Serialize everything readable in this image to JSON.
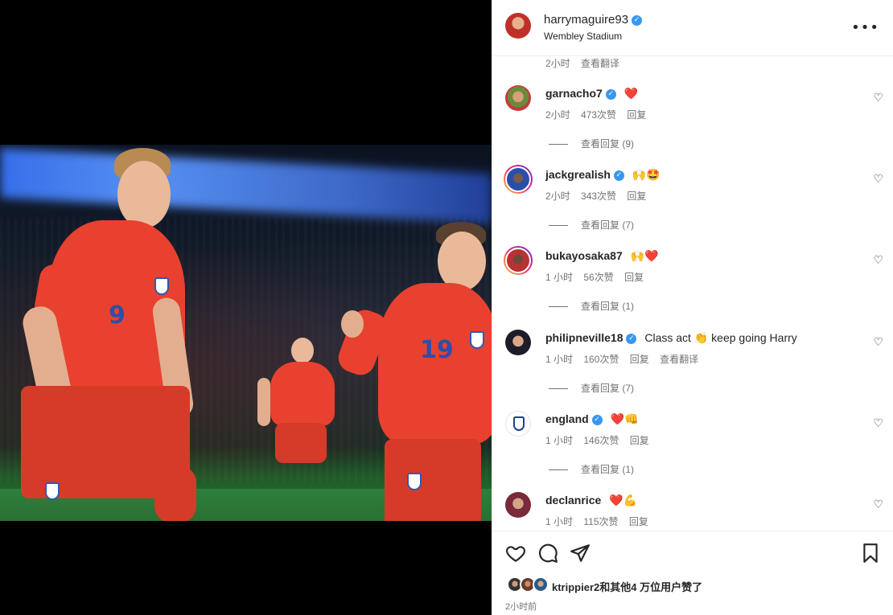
{
  "post": {
    "username": "harrymaguire93",
    "location": "Wembley Stadium"
  },
  "top_partial": {
    "time": "2小时",
    "translate": "查看翻译"
  },
  "comments": [
    {
      "username": "garnacho7",
      "text": "",
      "emoji": "❤️",
      "time": "2小时",
      "likes": "473次赞",
      "reply": "回复",
      "view_replies": "查看回复 (9)",
      "verified": true,
      "ring": false
    },
    {
      "username": "jackgrealish",
      "text": "",
      "emoji": "🙌🤩",
      "time": "2小时",
      "likes": "343次赞",
      "reply": "回复",
      "view_replies": "查看回复 (7)",
      "verified": true,
      "ring": true
    },
    {
      "username": "bukayosaka87",
      "text": "",
      "emoji": "🙌❤️",
      "time": "1 小时",
      "likes": "56次赞",
      "reply": "回复",
      "view_replies": "查看回复 (1)",
      "verified": false,
      "ring": true
    },
    {
      "username": "philipneville18",
      "text": "Class act 👏 keep going Harry",
      "emoji": "",
      "time": "1 小时",
      "likes": "160次赞",
      "reply": "回复",
      "translate": "查看翻译",
      "view_replies": "查看回复 (7)",
      "verified": true,
      "ring": false
    },
    {
      "username": "england",
      "text": "",
      "emoji": "❤️👊",
      "time": "1 小时",
      "likes": "146次赞",
      "reply": "回复",
      "view_replies": "查看回复 (1)",
      "verified": true,
      "ring": false
    },
    {
      "username": "declanrice",
      "text": "",
      "emoji": "❤️💪",
      "time": "1 小时",
      "likes": "115次赞",
      "reply": "回复",
      "verified": false,
      "ring": false
    }
  ],
  "footer": {
    "likes_user": "ktrippier2",
    "likes_text": "和其他4 万位用户赞了",
    "timestamp": "2小时前"
  },
  "icons": {
    "like": "heart-icon",
    "comment": "comment-icon",
    "share": "share-icon",
    "save": "bookmark-icon",
    "more": "more-options-icon",
    "verified": "verified-badge-icon"
  },
  "colors": {
    "verified": "#3897f0",
    "heart_red": "#ed4956",
    "secondary_text": "#737373",
    "shirt_red": "#e8412f"
  }
}
